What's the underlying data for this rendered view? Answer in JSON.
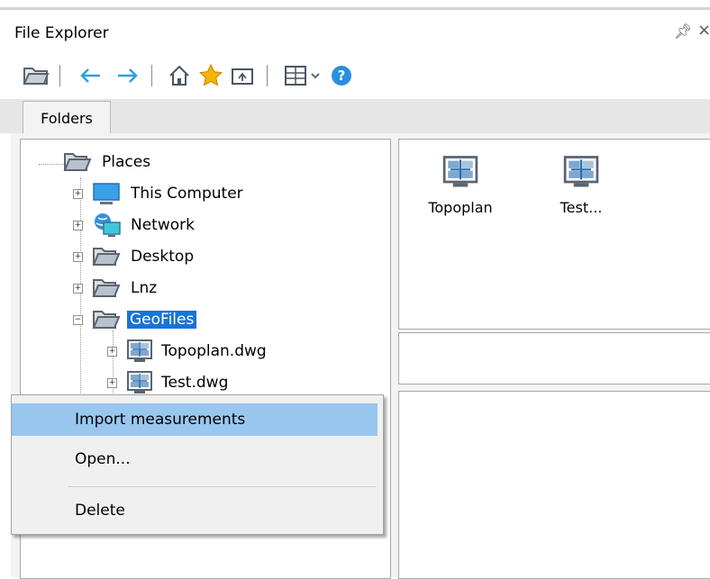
{
  "window": {
    "title": "File Explorer",
    "pin_icon": "pin-icon",
    "close_icon": "close-icon"
  },
  "toolbar": {
    "buttons": [
      {
        "name": "open-folder-icon"
      },
      {
        "name": "back-arrow-icon"
      },
      {
        "name": "forward-arrow-icon"
      },
      {
        "name": "home-icon"
      },
      {
        "name": "favorites-star-icon"
      },
      {
        "name": "upload-folder-icon"
      },
      {
        "name": "view-grid-icon"
      },
      {
        "name": "chevron-down-icon"
      },
      {
        "name": "help-icon"
      }
    ]
  },
  "tabs": [
    {
      "label": "Folders"
    }
  ],
  "tree": {
    "root": {
      "label": "Places",
      "icon": "folder-open-icon"
    },
    "items": [
      {
        "label": "This Computer",
        "icon": "computer-icon"
      },
      {
        "label": "Network",
        "icon": "network-icon"
      },
      {
        "label": "Desktop",
        "icon": "folder-icon"
      },
      {
        "label": "Lnz",
        "icon": "folder-icon"
      },
      {
        "label": "GeoFiles",
        "icon": "folder-open-icon",
        "selected": true,
        "expanded": true
      },
      {
        "label": "Topoplan.dwg",
        "icon": "dwg-file-icon"
      },
      {
        "label": "Test.dwg",
        "icon": "dwg-file-icon"
      }
    ]
  },
  "files": [
    {
      "label": "Topoplan",
      "icon": "dwg-file-icon"
    },
    {
      "label": "Test...",
      "icon": "dwg-file-icon"
    }
  ],
  "context_menu": {
    "items": [
      {
        "label": "Import measurements",
        "highlighted": true
      },
      {
        "label": "Open..."
      },
      {
        "label": "Delete"
      }
    ]
  },
  "colors": {
    "selection": "#1a73d6",
    "menu_highlight": "#99c7f0"
  }
}
